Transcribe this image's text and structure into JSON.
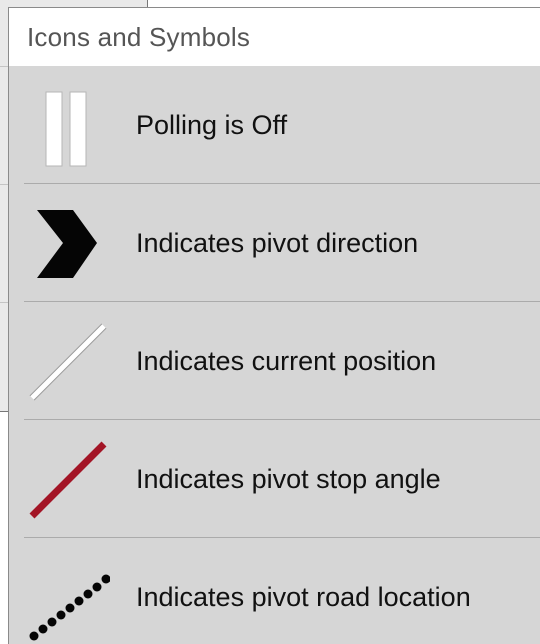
{
  "popover": {
    "title": "Icons and Symbols",
    "items": [
      {
        "label": "Polling is Off",
        "icon": "pause-icon"
      },
      {
        "label": "Indicates pivot direction",
        "icon": "chevron-right-icon",
        "color": "#000000"
      },
      {
        "label": "Indicates current position",
        "icon": "current-position-line-icon",
        "color": "#ffffff"
      },
      {
        "label": "Indicates pivot stop angle",
        "icon": "stop-angle-line-icon",
        "color": "#a31526"
      },
      {
        "label": "Indicates pivot road location",
        "icon": "road-location-dots-icon",
        "color": "#000000"
      }
    ]
  }
}
